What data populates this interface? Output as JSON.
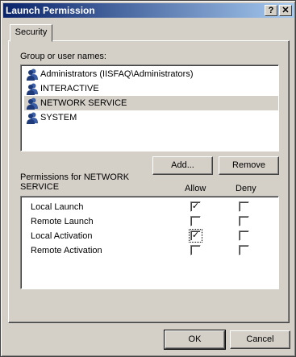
{
  "window": {
    "title": "Launch Permission",
    "help_label": "?",
    "close_label": "✕"
  },
  "tabs": [
    {
      "label": "Security"
    }
  ],
  "group_label": "Group or user names:",
  "users": [
    {
      "label": "Administrators (IISFAQ\\Administrators)",
      "icon": "users-icon",
      "selected": false
    },
    {
      "label": "INTERACTIVE",
      "icon": "users-icon",
      "selected": false
    },
    {
      "label": "NETWORK SERVICE",
      "icon": "users-icon",
      "selected": true
    },
    {
      "label": "SYSTEM",
      "icon": "users-icon",
      "selected": false
    }
  ],
  "buttons": {
    "add": "Add...",
    "remove": "Remove",
    "ok": "OK",
    "cancel": "Cancel"
  },
  "permissions": {
    "header_line1": "Permissions for NETWORK",
    "header_line2": "SERVICE",
    "allow_label": "Allow",
    "deny_label": "Deny",
    "check_mark": "✓",
    "rows": [
      {
        "label": "Local Launch",
        "allow": true,
        "deny": false
      },
      {
        "label": "Remote Launch",
        "allow": false,
        "deny": false
      },
      {
        "label": "Local Activation",
        "allow": true,
        "deny": false
      },
      {
        "label": "Remote Activation",
        "allow": false,
        "deny": false
      }
    ]
  },
  "colors": {
    "face": "#d4d0c8",
    "title_start": "#0a246a",
    "title_end": "#a6caf0"
  }
}
